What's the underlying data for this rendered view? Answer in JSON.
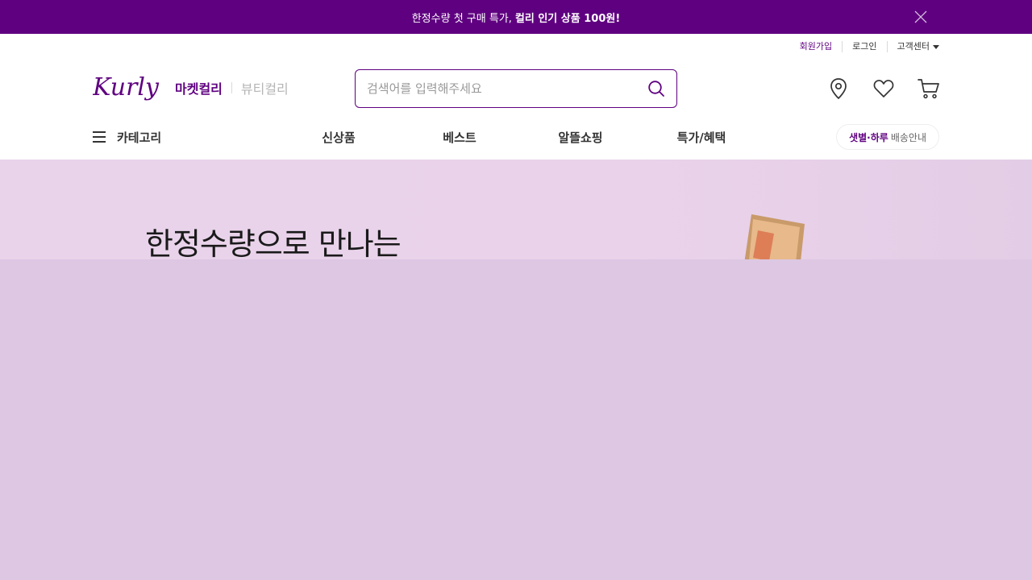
{
  "promo": {
    "text_normal": "한정수량 첫 구매 특가,",
    "text_bold": "컬리 인기 상품 100원!"
  },
  "util": {
    "signup": "회원가입",
    "login": "로그인",
    "customer_center": "고객센터"
  },
  "brand": {
    "logo_text": "Kurly",
    "market_tab": "마켓컬리",
    "beauty_tab": "뷰티컬리"
  },
  "search": {
    "placeholder": "검색어를 입력해주세요"
  },
  "nav": {
    "category": "카테고리",
    "items": [
      "신상품",
      "베스트",
      "알뜰쇼핑",
      "특가/혜택"
    ],
    "delivery_highlight": "샛별·하루",
    "delivery_rest": "배송안내"
  },
  "hero": {
    "title": "한정수량으로 만나는"
  },
  "colors": {
    "brand": "#5f0080",
    "banner_bg": "#ddc7e3"
  }
}
